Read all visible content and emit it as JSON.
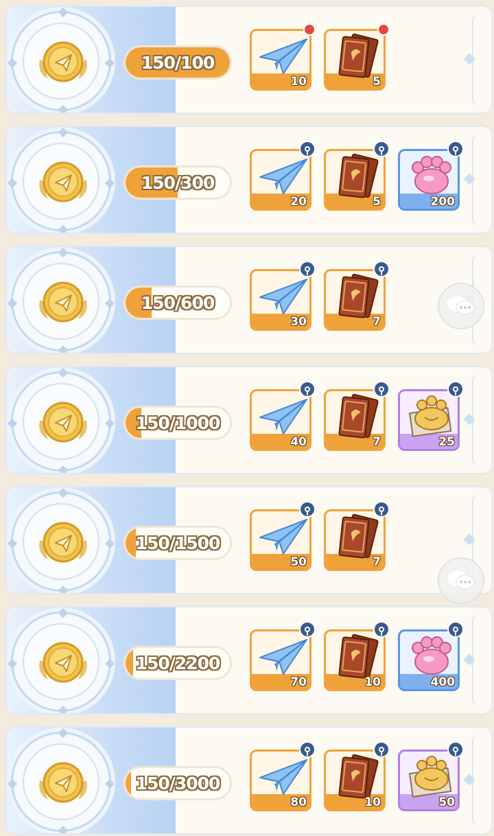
{
  "rows": [
    {
      "progress": "150/100",
      "fill": 1.0,
      "rewards": [
        {
          "type": "paper-plane",
          "qty": "10",
          "frame": "orange",
          "badge": "red"
        },
        {
          "type": "ticket-card",
          "qty": "5",
          "frame": "orange",
          "badge": "red"
        }
      ]
    },
    {
      "progress": "150/300",
      "fill": 0.5,
      "rewards": [
        {
          "type": "paper-plane",
          "qty": "20",
          "frame": "orange",
          "badge": "lock"
        },
        {
          "type": "ticket-card",
          "qty": "5",
          "frame": "orange",
          "badge": "lock"
        },
        {
          "type": "paw-candy",
          "qty": "200",
          "frame": "blue",
          "badge": "lock"
        }
      ]
    },
    {
      "progress": "150/600",
      "fill": 0.25,
      "rewards": [
        {
          "type": "paper-plane",
          "qty": "30",
          "frame": "orange",
          "badge": "lock"
        },
        {
          "type": "ticket-card",
          "qty": "7",
          "frame": "orange",
          "badge": "lock"
        }
      ]
    },
    {
      "progress": "150/1000",
      "fill": 0.15,
      "rewards": [
        {
          "type": "paper-plane",
          "qty": "40",
          "frame": "orange",
          "badge": "lock"
        },
        {
          "type": "ticket-card",
          "qty": "7",
          "frame": "orange",
          "badge": "lock"
        },
        {
          "type": "paw-cookie",
          "qty": "25",
          "frame": "purple",
          "badge": "lock"
        }
      ]
    },
    {
      "progress": "150/1500",
      "fill": 0.1,
      "rewards": [
        {
          "type": "paper-plane",
          "qty": "50",
          "frame": "orange",
          "badge": "lock"
        },
        {
          "type": "ticket-card",
          "qty": "7",
          "frame": "orange",
          "badge": "lock"
        }
      ]
    },
    {
      "progress": "150/2200",
      "fill": 0.068,
      "rewards": [
        {
          "type": "paper-plane",
          "qty": "70",
          "frame": "orange",
          "badge": "lock"
        },
        {
          "type": "ticket-card",
          "qty": "10",
          "frame": "orange",
          "badge": "lock"
        },
        {
          "type": "paw-candy",
          "qty": "400",
          "frame": "blue",
          "badge": "lock"
        }
      ]
    },
    {
      "progress": "150/3000",
      "fill": 0.05,
      "rewards": [
        {
          "type": "paper-plane",
          "qty": "80",
          "frame": "orange",
          "badge": "lock"
        },
        {
          "type": "ticket-card",
          "qty": "10",
          "frame": "orange",
          "badge": "lock"
        },
        {
          "type": "paw-cookie",
          "qty": "50",
          "frame": "purple",
          "badge": "lock"
        }
      ]
    }
  ],
  "icons": {
    "medal": "paper-plane-medal-icon",
    "chat": "chat-bubble-icon"
  },
  "colors": {
    "progress_fill": "#f0a23a",
    "orange_frame": "#f0a23a",
    "blue_frame": "#5a94e2",
    "purple_frame": "#b17de8",
    "lock_badge": "#3a5a8c",
    "red_badge": "#e8473f"
  }
}
